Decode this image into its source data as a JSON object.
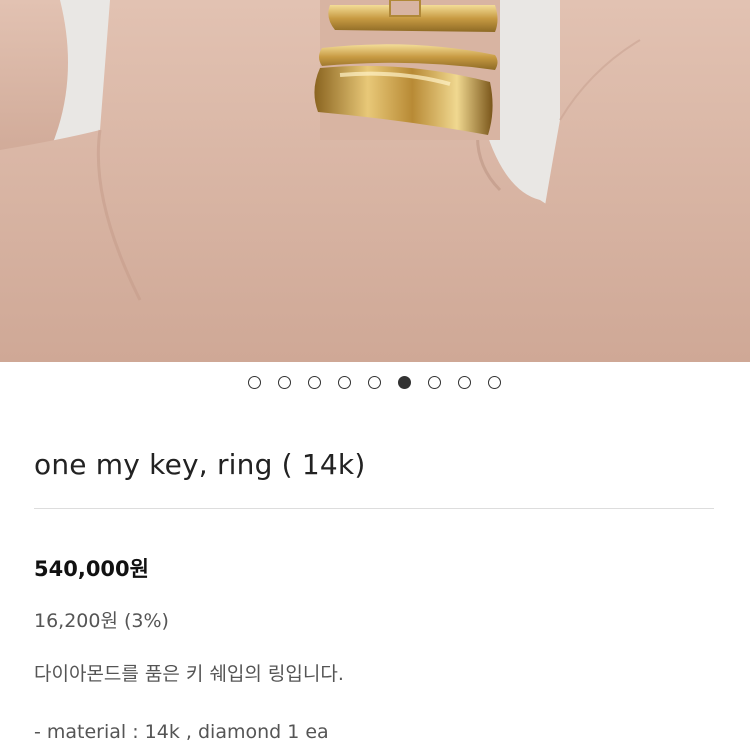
{
  "gallery": {
    "image_alt": "hand wearing stacked gold rings",
    "slide_count": 9,
    "active_slide": 6
  },
  "product": {
    "title": "one my key, ring ( 14k)",
    "price": "540,000원",
    "reward": "16,200원 (3%)",
    "description": "다이아몬드를 품은 키 쉐입의 링입니다.",
    "material": "- material : 14k , diamond 1 ea"
  },
  "colors": {
    "skin": "#d9b8a8",
    "background": "#e9e7e4",
    "gold": "#c9a24a",
    "dot_border": "#333333",
    "text": "#222222"
  }
}
